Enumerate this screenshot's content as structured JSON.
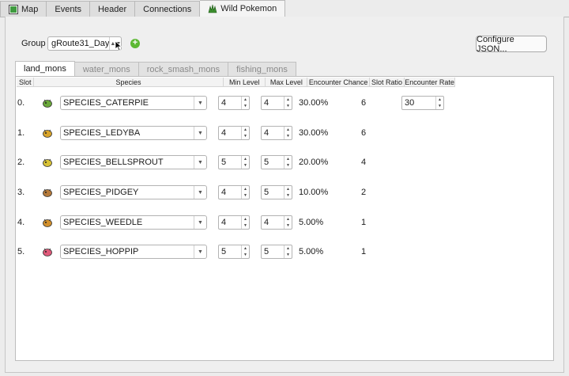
{
  "top_tabs": [
    {
      "label": "Map",
      "icon": "map-icon"
    },
    {
      "label": "Events",
      "icon": ""
    },
    {
      "label": "Header",
      "icon": ""
    },
    {
      "label": "Connections",
      "icon": ""
    },
    {
      "label": "Wild Pokemon",
      "icon": "grass-icon",
      "active": true
    }
  ],
  "group": {
    "label": "Group",
    "value": "gRoute31_Day"
  },
  "configure_button": "Configure JSON...",
  "inner_tabs": [
    {
      "label": "land_mons",
      "active": true
    },
    {
      "label": "water_mons"
    },
    {
      "label": "rock_smash_mons"
    },
    {
      "label": "fishing_mons"
    }
  ],
  "columns": [
    "Slot",
    "Species",
    "Min Level",
    "Max Level",
    "Encounter Chance",
    "Slot Ratio",
    "Encounter Rate"
  ],
  "rows": [
    {
      "slot": "0.",
      "species": "SPECIES_CATERPIE",
      "min": "4",
      "max": "4",
      "chance": "30.00%",
      "ratio": "6",
      "sprite": "caterpie-icon",
      "color": "#6aa83a"
    },
    {
      "slot": "1.",
      "species": "SPECIES_LEDYBA",
      "min": "4",
      "max": "4",
      "chance": "30.00%",
      "ratio": "6",
      "sprite": "ledyba-icon",
      "color": "#d9a42a"
    },
    {
      "slot": "2.",
      "species": "SPECIES_BELLSPROUT",
      "min": "5",
      "max": "5",
      "chance": "20.00%",
      "ratio": "4",
      "sprite": "bellsprout-icon",
      "color": "#d8c236"
    },
    {
      "slot": "3.",
      "species": "SPECIES_PIDGEY",
      "min": "4",
      "max": "5",
      "chance": "10.00%",
      "ratio": "2",
      "sprite": "pidgey-icon",
      "color": "#b57a3a"
    },
    {
      "slot": "4.",
      "species": "SPECIES_WEEDLE",
      "min": "4",
      "max": "4",
      "chance": "5.00%",
      "ratio": "1",
      "sprite": "weedle-icon",
      "color": "#d2902c"
    },
    {
      "slot": "5.",
      "species": "SPECIES_HOPPIP",
      "min": "5",
      "max": "5",
      "chance": "5.00%",
      "ratio": "1",
      "sprite": "hoppip-icon",
      "color": "#e05a7a"
    }
  ],
  "encounter_rate": "30"
}
